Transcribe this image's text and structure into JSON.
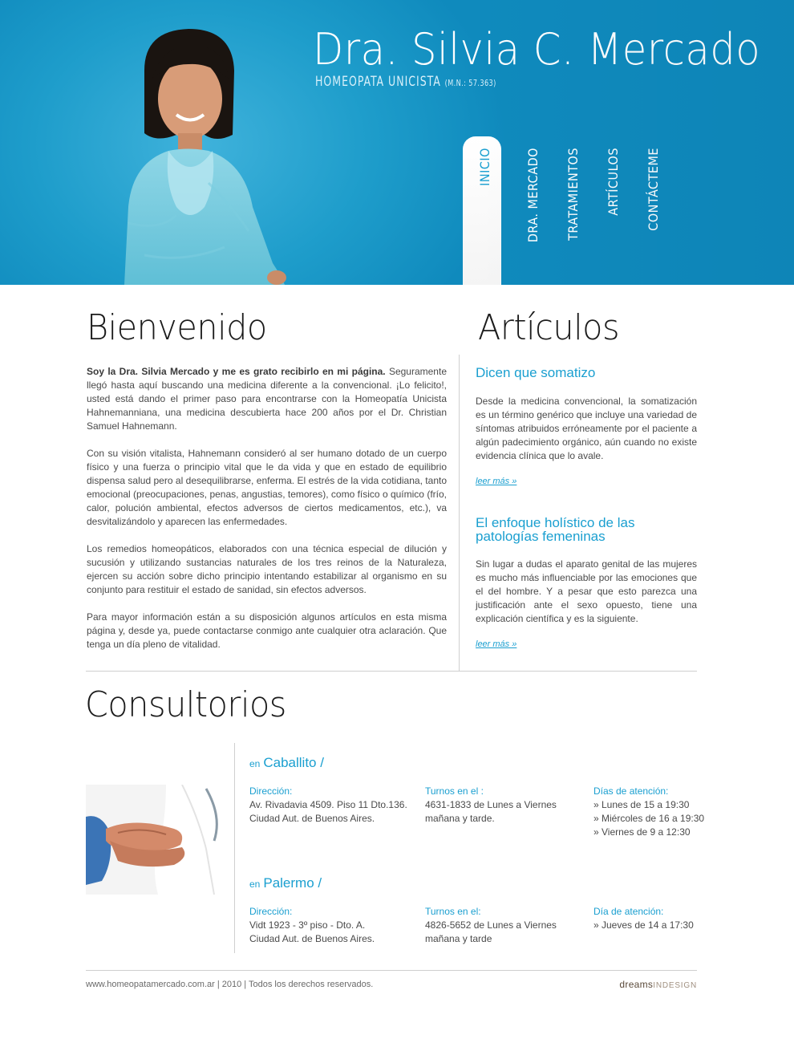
{
  "header": {
    "title": "Dra. Silvia C. Mercado",
    "subtitle": "HOMEOPATA UNICISTA",
    "registration": "(M.N.: 57.363)"
  },
  "nav": {
    "items": [
      {
        "label": "INICIO",
        "active": true
      },
      {
        "label": "DRA. MERCADO",
        "active": false
      },
      {
        "label": "TRATAMIENTOS",
        "active": false
      },
      {
        "label": "ARTÍCULOS",
        "active": false
      },
      {
        "label": "CONTÁCTEME",
        "active": false
      }
    ]
  },
  "welcome": {
    "heading": "Bienvenido",
    "intro_bold": "Soy la Dra. Silvia Mercado y me es grato recibirlo en mi página.",
    "intro_rest": " Seguramente llegó hasta aquí buscando una medicina diferente a la convencional. ¡Lo felicito!, usted está dando el primer paso para encontrarse con la Homeopatía Unicista Hahnemanniana, una medicina descubierta hace 200 años por el Dr. Christian Samuel Hahnemann.",
    "p2": "Con su visión vitalista, Hahnemann consideró al ser humano dotado de un cuerpo físico y una fuerza o principio vital que le da vida y que en estado de equilibrio dispensa salud pero al desequilibrarse, enferma. El estrés de la vida cotidiana, tanto emocional (preocupaciones, penas, angustias, temores), como físico o químico (frío, calor, polución ambiental, efectos adversos de ciertos medicamentos, etc.), va desvitalizándolo y aparecen las enfermedades.",
    "p3": "Los remedios homeopáticos, elaborados con una técnica especial de dilución y sucusión y utilizando sustancias naturales de los tres reinos de la Naturaleza, ejercen su acción sobre dicho principio intentando estabilizar al organismo en su conjunto para restituir el estado de sanidad, sin efectos adversos.",
    "p4": "Para mayor información están a su disposición algunos artículos en esta misma página y, desde ya, puede contactarse conmigo ante cualquier otra aclaración. Que tenga un día pleno de vitalidad."
  },
  "articles": {
    "heading": "Artículos",
    "items": [
      {
        "title": "Dicen que somatizo",
        "body": "Desde la medicina convencional, la somatización es un término genérico que incluye una variedad de síntomas atribuidos erróneamente por el paciente a algún padecimiento orgánico, aún cuando no existe evidencia clínica que lo avale.",
        "link": "leer más »"
      },
      {
        "title": "El enfoque holístico de las patologías femeninas",
        "body": "Sin lugar a dudas el aparato genital de las mujeres es mucho más influenciable por las emociones que el del hombre. Y a pesar que esto parezca una justificación ante el sexo opuesto, tiene una explicación científica y es la siguiente.",
        "link": "leer más »"
      }
    ]
  },
  "offices": {
    "heading": "Consultorios",
    "en": "en",
    "items": [
      {
        "name": "Caballito /",
        "address_label": "Dirección:",
        "address_1": "Av. Rivadavia 4509. Piso 11 Dto.136.",
        "address_2": "Ciudad Aut. de Buenos Aires.",
        "turnos_label": "Turnos en el :",
        "turnos_1": "4631-1833 de Lunes a Viernes",
        "turnos_2": "mañana y tarde.",
        "days_label": "Días de atención:",
        "days": [
          "» Lunes de 15 a 19:30",
          "» Miércoles de 16 a 19:30",
          "» Viernes de 9 a 12:30"
        ]
      },
      {
        "name": "Palermo /",
        "address_label": "Dirección:",
        "address_1": "Vidt 1923 - 3º piso - Dto. A.",
        "address_2": "Ciudad Aut. de Buenos Aires.",
        "turnos_label": "Turnos en el:",
        "turnos_1": "4826-5652 de Lunes a Viernes",
        "turnos_2": "mañana y tarde",
        "days_label": "Día de atención:",
        "days": [
          "» Jueves de 14 a 17:30"
        ]
      }
    ]
  },
  "footer": {
    "text": "www.homeopatamercado.com.ar | 2010 | Todos los derechos reservados.",
    "brand_a": "dreams",
    "brand_b": "INDESIGN"
  },
  "colors": {
    "accent": "#1a9fd0",
    "header_bg": "#1e9dcb",
    "text": "#4a4a4a"
  }
}
